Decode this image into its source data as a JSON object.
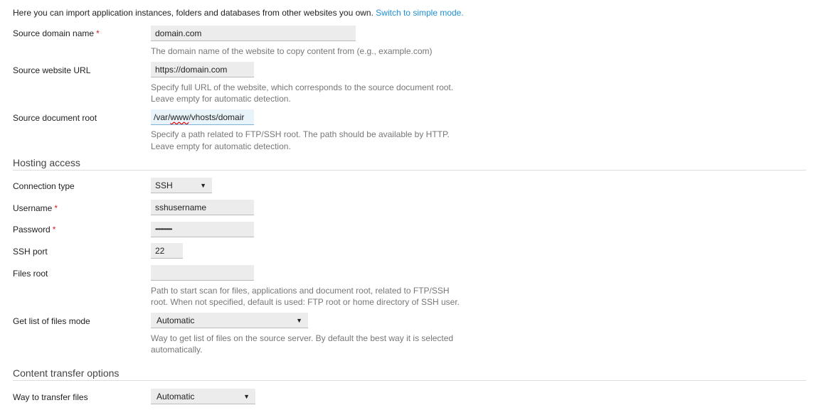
{
  "intro": {
    "text": "Here you can import application instances, folders and databases from other websites you own.",
    "link": "Switch to simple mode."
  },
  "source_domain": {
    "label": "Source domain name",
    "required": "*",
    "value": "domain.com",
    "hint": "The domain name of the website to copy content from (e.g., example.com)"
  },
  "source_url": {
    "label": "Source website URL",
    "value": "https://domain.com",
    "hint1": "Specify full URL of the website, which corresponds to the source document root.",
    "hint2": "Leave empty for automatic detection."
  },
  "source_root": {
    "label": "Source document root",
    "value_pre": "/var/",
    "value_spell": "www",
    "value_post": "/vhosts/domair",
    "hint1": "Specify a path related to FTP/SSH root. The path should be available by HTTP.",
    "hint2": "Leave empty for automatic detection."
  },
  "hosting": {
    "heading": "Hosting access",
    "connection_type": {
      "label": "Connection type",
      "value": "SSH"
    },
    "username": {
      "label": "Username",
      "required": "*",
      "value": "sshusername"
    },
    "password": {
      "label": "Password",
      "required": "*",
      "value": "•••••••••••••"
    },
    "ssh_port": {
      "label": "SSH port",
      "value": "22"
    },
    "files_root": {
      "label": "Files root",
      "value": "",
      "hint1": "Path to start scan for files, applications and document root, related to FTP/SSH",
      "hint2": "root. When not specified, default is used: FTP root or home directory of SSH user."
    },
    "list_mode": {
      "label": "Get list of files mode",
      "value": "Automatic",
      "hint1": "Way to get list of files on the source server. By default the best way it is selected",
      "hint2": "automatically."
    }
  },
  "transfer": {
    "heading": "Content transfer options",
    "way": {
      "label": "Way to transfer files",
      "value": "Automatic"
    }
  },
  "icons": {
    "dropdown": "triangle-down-icon"
  },
  "colors": {
    "link": "#1d8fd3",
    "required": "#d02020",
    "input_bg": "#ececec",
    "focused_input_bg": "#e9f3fa"
  }
}
